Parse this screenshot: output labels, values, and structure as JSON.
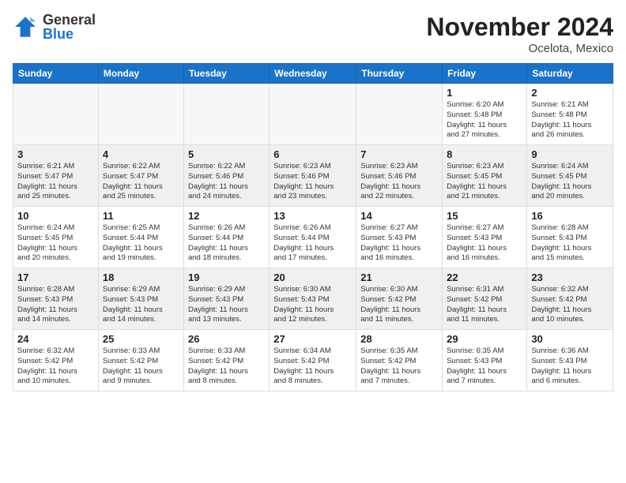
{
  "header": {
    "logo_general": "General",
    "logo_blue": "Blue",
    "month_title": "November 2024",
    "location": "Ocelota, Mexico"
  },
  "days_of_week": [
    "Sunday",
    "Monday",
    "Tuesday",
    "Wednesday",
    "Thursday",
    "Friday",
    "Saturday"
  ],
  "weeks": [
    {
      "shaded": false,
      "days": [
        {
          "date": "",
          "info": ""
        },
        {
          "date": "",
          "info": ""
        },
        {
          "date": "",
          "info": ""
        },
        {
          "date": "",
          "info": ""
        },
        {
          "date": "",
          "info": ""
        },
        {
          "date": "1",
          "info": "Sunrise: 6:20 AM\nSunset: 5:48 PM\nDaylight: 11 hours\nand 27 minutes."
        },
        {
          "date": "2",
          "info": "Sunrise: 6:21 AM\nSunset: 5:48 PM\nDaylight: 11 hours\nand 26 minutes."
        }
      ]
    },
    {
      "shaded": true,
      "days": [
        {
          "date": "3",
          "info": "Sunrise: 6:21 AM\nSunset: 5:47 PM\nDaylight: 11 hours\nand 25 minutes."
        },
        {
          "date": "4",
          "info": "Sunrise: 6:22 AM\nSunset: 5:47 PM\nDaylight: 11 hours\nand 25 minutes."
        },
        {
          "date": "5",
          "info": "Sunrise: 6:22 AM\nSunset: 5:46 PM\nDaylight: 11 hours\nand 24 minutes."
        },
        {
          "date": "6",
          "info": "Sunrise: 6:23 AM\nSunset: 5:46 PM\nDaylight: 11 hours\nand 23 minutes."
        },
        {
          "date": "7",
          "info": "Sunrise: 6:23 AM\nSunset: 5:46 PM\nDaylight: 11 hours\nand 22 minutes."
        },
        {
          "date": "8",
          "info": "Sunrise: 6:23 AM\nSunset: 5:45 PM\nDaylight: 11 hours\nand 21 minutes."
        },
        {
          "date": "9",
          "info": "Sunrise: 6:24 AM\nSunset: 5:45 PM\nDaylight: 11 hours\nand 20 minutes."
        }
      ]
    },
    {
      "shaded": false,
      "days": [
        {
          "date": "10",
          "info": "Sunrise: 6:24 AM\nSunset: 5:45 PM\nDaylight: 11 hours\nand 20 minutes."
        },
        {
          "date": "11",
          "info": "Sunrise: 6:25 AM\nSunset: 5:44 PM\nDaylight: 11 hours\nand 19 minutes."
        },
        {
          "date": "12",
          "info": "Sunrise: 6:26 AM\nSunset: 5:44 PM\nDaylight: 11 hours\nand 18 minutes."
        },
        {
          "date": "13",
          "info": "Sunrise: 6:26 AM\nSunset: 5:44 PM\nDaylight: 11 hours\nand 17 minutes."
        },
        {
          "date": "14",
          "info": "Sunrise: 6:27 AM\nSunset: 5:43 PM\nDaylight: 11 hours\nand 16 minutes."
        },
        {
          "date": "15",
          "info": "Sunrise: 6:27 AM\nSunset: 5:43 PM\nDaylight: 11 hours\nand 16 minutes."
        },
        {
          "date": "16",
          "info": "Sunrise: 6:28 AM\nSunset: 5:43 PM\nDaylight: 11 hours\nand 15 minutes."
        }
      ]
    },
    {
      "shaded": true,
      "days": [
        {
          "date": "17",
          "info": "Sunrise: 6:28 AM\nSunset: 5:43 PM\nDaylight: 11 hours\nand 14 minutes."
        },
        {
          "date": "18",
          "info": "Sunrise: 6:29 AM\nSunset: 5:43 PM\nDaylight: 11 hours\nand 14 minutes."
        },
        {
          "date": "19",
          "info": "Sunrise: 6:29 AM\nSunset: 5:43 PM\nDaylight: 11 hours\nand 13 minutes."
        },
        {
          "date": "20",
          "info": "Sunrise: 6:30 AM\nSunset: 5:43 PM\nDaylight: 11 hours\nand 12 minutes."
        },
        {
          "date": "21",
          "info": "Sunrise: 6:30 AM\nSunset: 5:42 PM\nDaylight: 11 hours\nand 11 minutes."
        },
        {
          "date": "22",
          "info": "Sunrise: 6:31 AM\nSunset: 5:42 PM\nDaylight: 11 hours\nand 11 minutes."
        },
        {
          "date": "23",
          "info": "Sunrise: 6:32 AM\nSunset: 5:42 PM\nDaylight: 11 hours\nand 10 minutes."
        }
      ]
    },
    {
      "shaded": false,
      "days": [
        {
          "date": "24",
          "info": "Sunrise: 6:32 AM\nSunset: 5:42 PM\nDaylight: 11 hours\nand 10 minutes."
        },
        {
          "date": "25",
          "info": "Sunrise: 6:33 AM\nSunset: 5:42 PM\nDaylight: 11 hours\nand 9 minutes."
        },
        {
          "date": "26",
          "info": "Sunrise: 6:33 AM\nSunset: 5:42 PM\nDaylight: 11 hours\nand 8 minutes."
        },
        {
          "date": "27",
          "info": "Sunrise: 6:34 AM\nSunset: 5:42 PM\nDaylight: 11 hours\nand 8 minutes."
        },
        {
          "date": "28",
          "info": "Sunrise: 6:35 AM\nSunset: 5:42 PM\nDaylight: 11 hours\nand 7 minutes."
        },
        {
          "date": "29",
          "info": "Sunrise: 6:35 AM\nSunset: 5:43 PM\nDaylight: 11 hours\nand 7 minutes."
        },
        {
          "date": "30",
          "info": "Sunrise: 6:36 AM\nSunset: 5:43 PM\nDaylight: 11 hours\nand 6 minutes."
        }
      ]
    }
  ]
}
